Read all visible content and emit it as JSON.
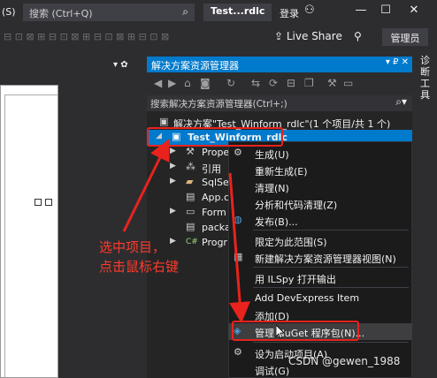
{
  "titlebar": {
    "search_placeholder": "搜索 (Ctrl+Q)",
    "solution_name": "Test...rdlc",
    "login_label": "登录",
    "menu_partial": "(S)"
  },
  "toolbar2": {
    "live_share_label": "Live Share",
    "admin_label": "管理员"
  },
  "solution_explorer": {
    "title": "解决方案资源管理器",
    "title_pins": "▾ ₽ ✕",
    "search_placeholder": "搜索解决方案资源管理器(Ctrl+;)",
    "tree": [
      {
        "label": "解决方案\"Test_Winform_rdlc\"(1 个项目/共 1 个)"
      },
      {
        "label": "Test_Winform_rdlc"
      },
      {
        "label": "Prope"
      },
      {
        "label": "引用"
      },
      {
        "label": "SqlSer"
      },
      {
        "label": "App.c"
      },
      {
        "label": "Form"
      },
      {
        "label": "packa"
      },
      {
        "label": "Progr"
      }
    ]
  },
  "right_strip": {
    "label": "诊断工具"
  },
  "context_menu": {
    "items": [
      {
        "label": "生成(U)"
      },
      {
        "label": "重新生成(E)"
      },
      {
        "label": "清理(N)"
      },
      {
        "label": "分析和代码清理(Z)"
      },
      {
        "label": "发布(B)..."
      },
      {
        "label": "限定为此范围(S)"
      },
      {
        "label": "新建解决方案资源管理器视图(N)"
      },
      {
        "label": "用 ILSpy 打开输出"
      },
      {
        "label": "Add DevExpress Item"
      },
      {
        "label": "添加(D)"
      },
      {
        "label": "管理 NuGet 程序包(N)..."
      },
      {
        "label": "设为启动项目(A)"
      },
      {
        "label": "调试(G)"
      }
    ]
  },
  "annotation": {
    "line1": "选中项目，",
    "line2": "点击鼠标右键"
  },
  "watermark": "CSDN @gewen_1988",
  "colors": {
    "accent": "#007acc",
    "annotation_red": "#e8231d"
  }
}
